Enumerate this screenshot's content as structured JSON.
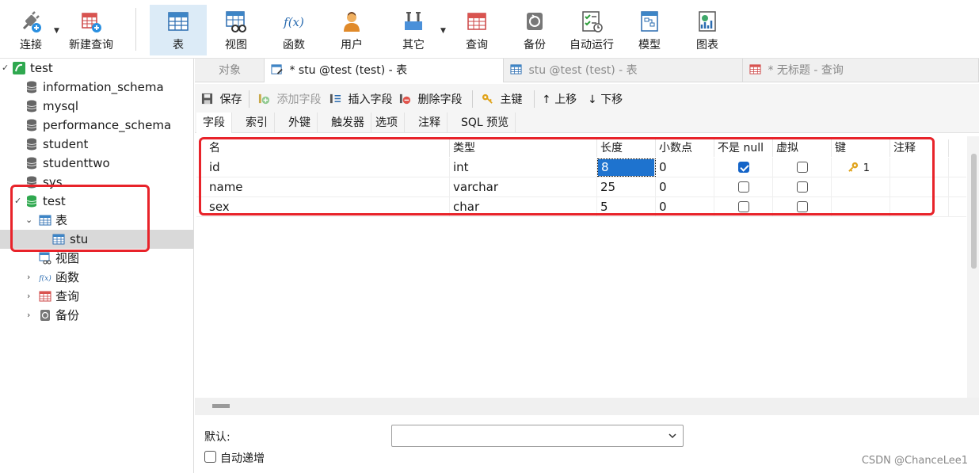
{
  "toolbar": {
    "connect": "连接",
    "new_query": "新建查询",
    "table": "表",
    "view": "视图",
    "function": "函数",
    "user": "用户",
    "other": "其它",
    "query": "查询",
    "backup": "备份",
    "auto_run": "自动运行",
    "model": "模型",
    "chart": "图表",
    "function_glyph": "f(x)"
  },
  "nav": {
    "connection": "test",
    "databases": [
      "information_schema",
      "mysql",
      "performance_schema",
      "student",
      "studenttwo",
      "sys"
    ],
    "open_db": "test",
    "tables_group": "表",
    "table_item": "stu",
    "views_group": "视图",
    "functions_group": "函数",
    "queries_group": "查询",
    "backups_group": "备份"
  },
  "tabs": {
    "objects": "对象",
    "design_tab": "* stu @test (test) - 表",
    "data_tab": "stu @test (test) - 表",
    "query_tab": "* 无标题 - 查询"
  },
  "objbar": {
    "save": "保存",
    "add_field": "添加字段",
    "insert_field": "插入字段",
    "delete_field": "删除字段",
    "primary_key": "主键",
    "move_up": "上移",
    "move_down": "下移"
  },
  "subtabs": [
    "字段",
    "索引",
    "外键",
    "触发器",
    "选项",
    "注释",
    "SQL 预览"
  ],
  "grid": {
    "headers": [
      "名",
      "类型",
      "长度",
      "小数点",
      "不是 null",
      "虚拟",
      "键",
      "注释"
    ],
    "rows": [
      {
        "name": "id",
        "type": "int",
        "length": "8",
        "decimals": "0",
        "not_null": true,
        "virtual": false,
        "key": "1"
      },
      {
        "name": "name",
        "type": "varchar",
        "length": "25",
        "decimals": "0",
        "not_null": false,
        "virtual": false,
        "key": ""
      },
      {
        "name": "sex",
        "type": "char",
        "length": "5",
        "decimals": "0",
        "not_null": false,
        "virtual": false,
        "key": ""
      }
    ]
  },
  "props": {
    "default_label": "默认:",
    "default_value": "",
    "auto_increment_label": "自动递增"
  },
  "watermark": "CSDN @ChanceLee1",
  "colors": {
    "highlight_box": "#e8232a",
    "selection": "#1e73cf",
    "checkbox_checked": "#1464c8",
    "toolbar_active": "#dcebf7"
  }
}
